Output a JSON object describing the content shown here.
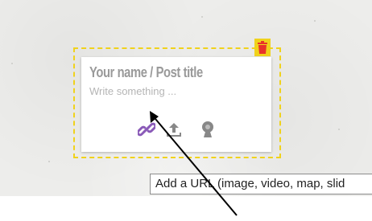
{
  "card": {
    "title_placeholder": "Your name / Post title",
    "body_placeholder": "Write something ...",
    "tools": [
      {
        "icon": "link-icon",
        "color": "#8a5ab8"
      },
      {
        "icon": "upload-icon",
        "color": "#888888"
      },
      {
        "icon": "webcam-icon",
        "color": "#888888"
      }
    ]
  },
  "selection": {
    "border_color": "#f0d21c",
    "delete_icon": "trash-icon",
    "delete_icon_color": "#e8332a"
  },
  "tooltip": {
    "text": "Add a URL (image, video, map, slid"
  },
  "annotation": {
    "arrow_color": "#000000"
  }
}
